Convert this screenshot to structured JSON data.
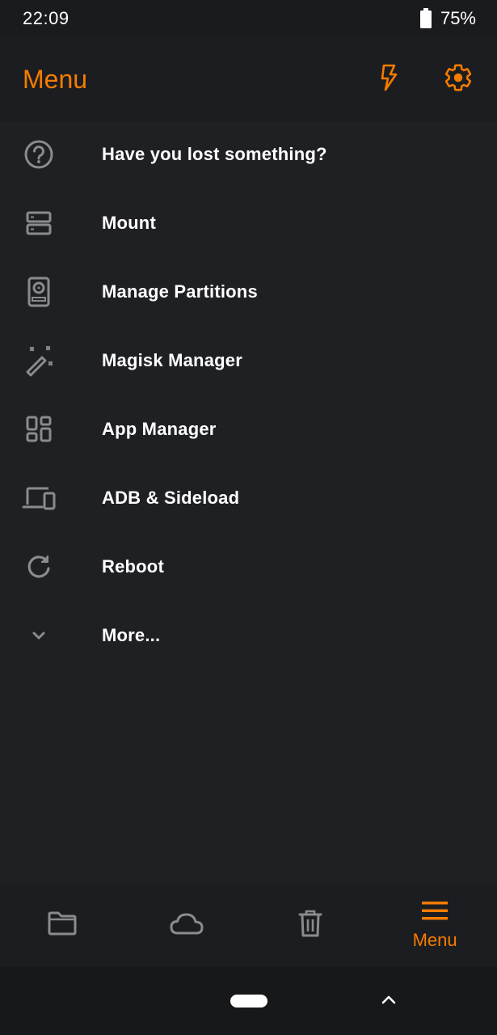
{
  "status_bar": {
    "time": "22:09",
    "battery": "75%",
    "battery_icon": "battery-icon"
  },
  "app_bar": {
    "title": "Menu",
    "actions": [
      {
        "icon": "flash-icon"
      },
      {
        "icon": "gear-icon"
      }
    ]
  },
  "menu": {
    "items": [
      {
        "label": "Have you lost something?",
        "icon": "help-circle-icon"
      },
      {
        "label": "Mount",
        "icon": "storage-icon"
      },
      {
        "label": "Manage Partitions",
        "icon": "harddisk-icon"
      },
      {
        "label": "Magisk Manager",
        "icon": "magic-wand-icon"
      },
      {
        "label": "App Manager",
        "icon": "dashboard-icon"
      },
      {
        "label": "ADB & Sideload",
        "icon": "devices-icon"
      },
      {
        "label": "Reboot",
        "icon": "refresh-icon"
      },
      {
        "label": "More...",
        "icon": "chevron-down-icon"
      }
    ]
  },
  "bottom_nav": {
    "items": [
      {
        "icon": "folder-icon",
        "label": ""
      },
      {
        "icon": "cloud-icon",
        "label": ""
      },
      {
        "icon": "trash-icon",
        "label": ""
      },
      {
        "icon": "hamburger-menu-icon",
        "label": "Menu",
        "active": true
      }
    ]
  },
  "colors": {
    "accent": "#f57c00",
    "background": "#1f2023",
    "icon_gray": "#8a8b8e"
  }
}
